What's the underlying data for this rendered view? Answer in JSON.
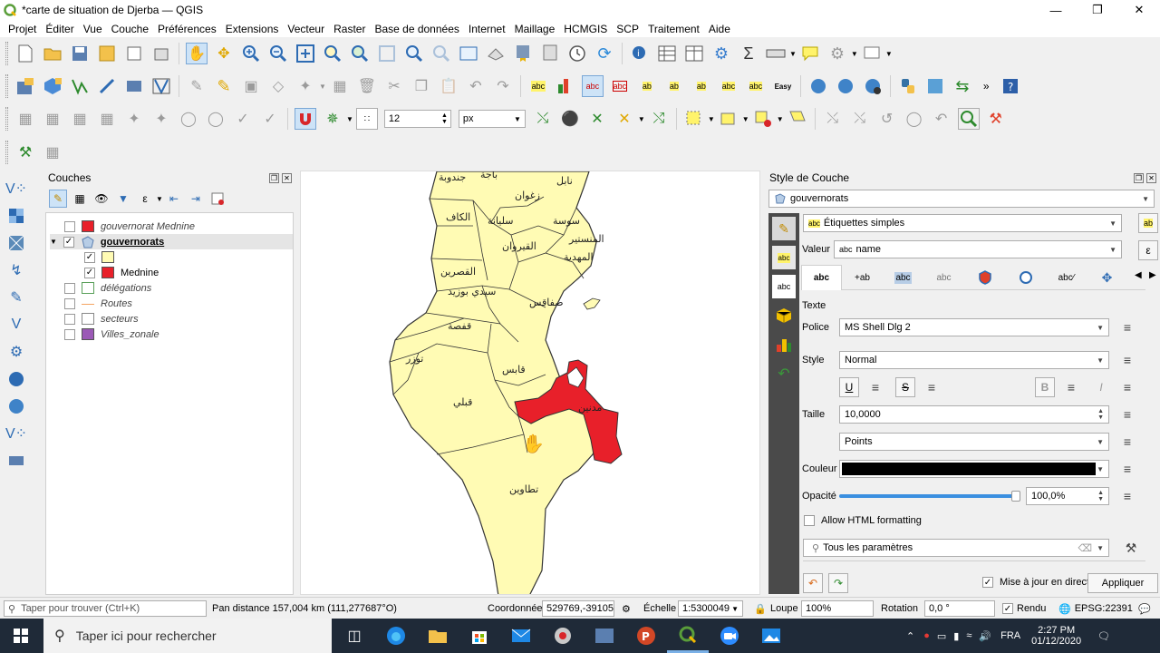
{
  "window": {
    "title": "*carte de situation de Djerba — QGIS"
  },
  "menu": [
    "Projet",
    "Éditer",
    "Vue",
    "Couche",
    "Préférences",
    "Extensions",
    "Vecteur",
    "Raster",
    "Base de données",
    "Internet",
    "Maillage",
    "HCMGIS",
    "SCP",
    "Traitement",
    "Aide"
  ],
  "toolbar": {
    "snap_size": "12",
    "snap_unit": "px"
  },
  "layers_panel": {
    "title": "Couches",
    "items": [
      {
        "name": "gouvernorat Mednine",
        "checked": false,
        "italic": true,
        "color": "#e8202a"
      },
      {
        "name": "gouvernorats",
        "checked": true,
        "bold": true
      },
      {
        "name": "",
        "checked": true,
        "color": "#fffbb4"
      },
      {
        "name": "Mednine",
        "checked": true,
        "color": "#e8202a"
      },
      {
        "name": "délégations",
        "checked": false,
        "italic": true
      },
      {
        "name": "Routes",
        "checked": false,
        "italic": true,
        "color": "#f4a460"
      },
      {
        "name": "secteurs",
        "checked": false,
        "italic": true
      },
      {
        "name": "Villes_zonale",
        "checked": false,
        "italic": true,
        "color": "#9b59b6"
      }
    ]
  },
  "map": {
    "labels": [
      "باجة",
      "جندوبة",
      "نابل",
      "زغوان",
      "الكاف",
      "سليانة",
      "سوسة",
      "المنستير",
      "القيروان",
      "المهدية",
      "القصرين",
      "سيدي بوزيد",
      "صفاقس",
      "قفصة",
      "توزر",
      "قابس",
      "قبلي",
      "مدنين",
      "تطاوين"
    ],
    "colors": {
      "fill": "#fffbb4",
      "highlight": "#e8202a",
      "stroke": "#333333"
    }
  },
  "style_panel": {
    "title": "Style de Couche",
    "layer": "gouvernorats",
    "label_mode": "Étiquettes simples",
    "value_label": "Valeur",
    "value": "name",
    "section": "Texte",
    "police_label": "Police",
    "police": "MS Shell Dlg 2",
    "style_label": "Style",
    "style": "Normal",
    "taille_label": "Taille",
    "taille": "10,0000",
    "unit": "Points",
    "couleur_label": "Couleur",
    "opacite_label": "Opacité",
    "opacite": "100,0%",
    "opacity_value": 1.0,
    "html_label": "Allow HTML formatting",
    "search_placeholder": "Tous les paramètres",
    "live_update": "Mise à jour en direct",
    "apply": "Appliquer",
    "tabs": [
      "abc",
      "+ab",
      "abc",
      "abc",
      "shield",
      "circle",
      "abc-line",
      "move"
    ]
  },
  "status": {
    "search_placeholder": "Taper pour trouver (Ctrl+K)",
    "message": "Pan distance 157,004 km (111,277687°O)",
    "coord_label": "Coordonnée",
    "coord": "529769,-39105",
    "scale_label": "Échelle",
    "scale": "1:5300049",
    "loupe_label": "Loupe",
    "loupe": "100%",
    "rotation_label": "Rotation",
    "rotation": "0,0 °",
    "render_label": "Rendu",
    "crs": "EPSG:22391"
  },
  "taskbar": {
    "search_placeholder": "Taper ici pour rechercher",
    "lang": "FRA",
    "time": "2:27 PM",
    "date": "01/12/2020"
  }
}
